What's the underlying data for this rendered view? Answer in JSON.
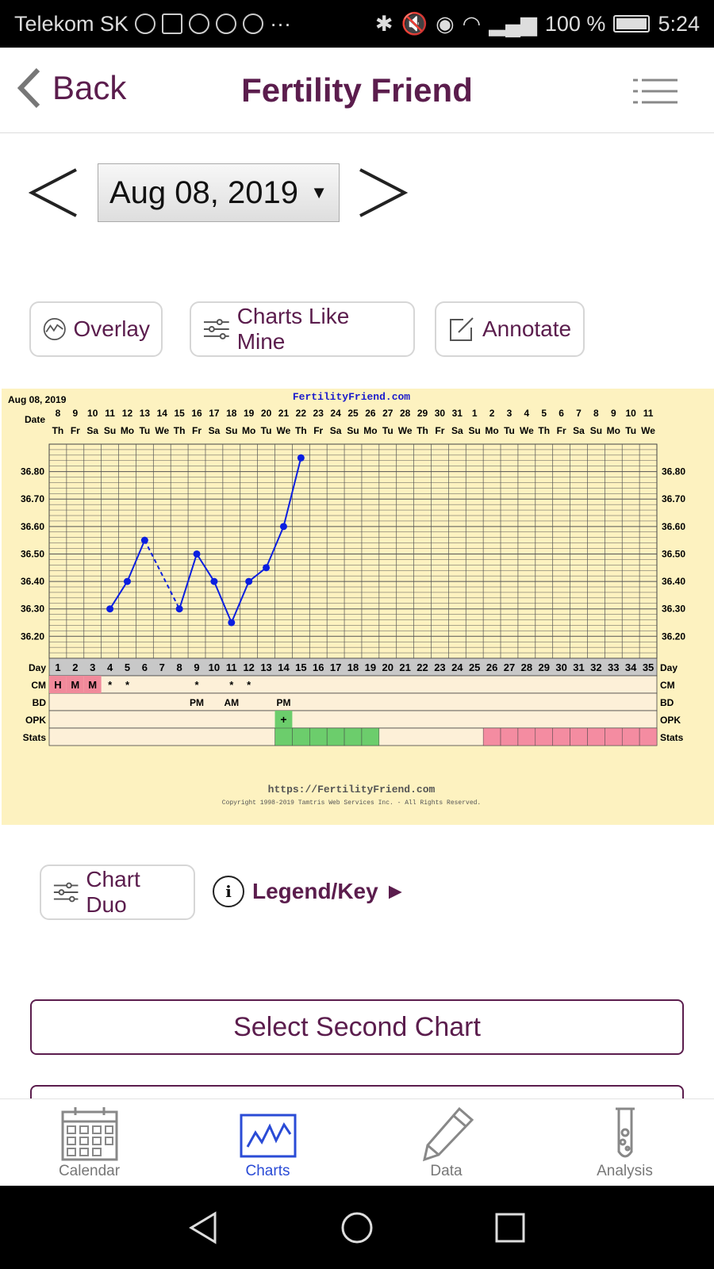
{
  "status": {
    "carrier": "Telekom SK",
    "more": "···",
    "battery": "100 %",
    "time": "5:24"
  },
  "header": {
    "back_label": "Back",
    "title": "Fertility Friend"
  },
  "date_nav": {
    "selected_date": "Aug 08, 2019",
    "caret": "▼"
  },
  "actions": {
    "overlay": "Overlay",
    "charts_like_mine": "Charts Like Mine",
    "annotate": "Annotate",
    "chart_duo": "Chart Duo",
    "legend_key": "Legend/Key ►",
    "select_second_chart": "Select Second Chart"
  },
  "chart_data": {
    "type": "line",
    "header_date": "Aug 08, 2019",
    "site_title": "FertilityFriend.com",
    "footer_url": "https://FertilityFriend.com",
    "copyright": "Copyright 1998-2019 Tamtris Web Services Inc. - All Rights Reserved.",
    "date_row_label": "Date",
    "dates": [
      "8",
      "9",
      "10",
      "11",
      "12",
      "13",
      "14",
      "15",
      "16",
      "17",
      "18",
      "19",
      "20",
      "21",
      "22",
      "23",
      "24",
      "25",
      "26",
      "27",
      "28",
      "29",
      "30",
      "31",
      "1",
      "2",
      "3",
      "4",
      "5",
      "6",
      "7",
      "8",
      "9",
      "10",
      "11"
    ],
    "weekdays": [
      "Th",
      "Fr",
      "Sa",
      "Su",
      "Mo",
      "Tu",
      "We",
      "Th",
      "Fr",
      "Sa",
      "Su",
      "Mo",
      "Tu",
      "We",
      "Th",
      "Fr",
      "Sa",
      "Su",
      "Mo",
      "Tu",
      "We",
      "Th",
      "Fr",
      "Sa",
      "Su",
      "Mo",
      "Tu",
      "We",
      "Th",
      "Fr",
      "Sa",
      "Su",
      "Mo",
      "Tu",
      "We"
    ],
    "y_ticks": [
      "36.80",
      "36.70",
      "36.60",
      "36.50",
      "36.40",
      "36.30",
      "36.20"
    ],
    "ylim": [
      36.12,
      36.9
    ],
    "temperatures": [
      null,
      null,
      null,
      36.3,
      36.4,
      36.55,
      null,
      36.3,
      36.5,
      36.4,
      36.25,
      36.4,
      36.45,
      36.6,
      36.85
    ],
    "dashed_segments": [
      [
        6,
        8
      ]
    ],
    "row_labels": [
      "Day",
      "CM",
      "BD",
      "OPK",
      "Stats"
    ],
    "cm": [
      "H",
      "M",
      "M",
      "*",
      "*",
      "",
      "",
      "",
      "*",
      "",
      "*",
      "*"
    ],
    "bd": {
      "9": "PM",
      "11": "AM",
      "14": "PM"
    },
    "opk": {
      "14": "+"
    },
    "stats_green_days": [
      14,
      15,
      16,
      17,
      18,
      19
    ],
    "stats_pink_days": [
      26,
      27,
      28,
      29,
      30,
      31,
      32,
      33,
      34,
      35
    ],
    "colors": {
      "line": "#0b1fe0",
      "grid": "#555555",
      "cm_pink": "#f18a9b",
      "green": "#6ccd6c",
      "pink": "#f48ca1",
      "row_bg": "#fdf0d8"
    }
  },
  "tabs": [
    {
      "label": "Calendar",
      "icon": "calendar-icon"
    },
    {
      "label": "Charts",
      "icon": "chart-icon"
    },
    {
      "label": "Data",
      "icon": "pencil-icon"
    },
    {
      "label": "Analysis",
      "icon": "test-tube-icon"
    }
  ]
}
